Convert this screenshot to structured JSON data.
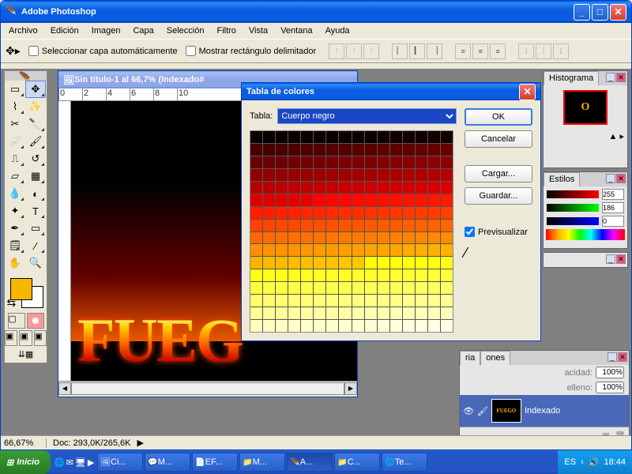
{
  "app": {
    "title": "Adobe Photoshop",
    "menus": [
      "Archivo",
      "Edición",
      "Imagen",
      "Capa",
      "Selección",
      "Filtro",
      "Vista",
      "Ventana",
      "Ayuda"
    ]
  },
  "optionsBar": {
    "autoSelect": "Seleccionar capa automáticamente",
    "showBox": "Mostrar rectángulo delimitador"
  },
  "document": {
    "title": "Sin título-1 al 66,7% (Indexado#",
    "fireText": "FUEG",
    "zoom": "66,67%",
    "docSize": "Doc: 293,0K/265,6K"
  },
  "dialog": {
    "title": "Tabla de colores",
    "tableLabel": "Tabla:",
    "tableValue": "Cuerpo negro",
    "ok": "OK",
    "cancel": "Cancelar",
    "load": "Cargar...",
    "save": "Guardar...",
    "preview": "Previsualizar"
  },
  "panels": {
    "hist": "Histograma",
    "styles": "Estilos",
    "color": {
      "r": "255",
      "g": "186",
      "b": "0"
    },
    "layersTab1": "ria",
    "layersTab2": "ones",
    "opacity": "acidad:",
    "opacityVal": "100%",
    "fill": "elleno:",
    "fillVal": "100%",
    "layerName": "Indexado"
  },
  "taskbar": {
    "start": "Inicio",
    "items": [
      "Ci...",
      "M...",
      "EF...",
      "M...",
      "A...",
      "C...",
      "Te..."
    ],
    "lang": "ES",
    "time": "18:44"
  }
}
